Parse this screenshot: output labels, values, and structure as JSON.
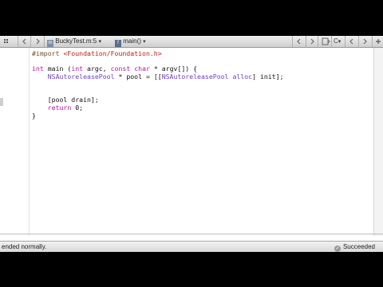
{
  "jump_bar": {
    "file": "BuckyTest.m:5",
    "function": "main()",
    "file_icon": "objc-file-icon",
    "function_icon": "function-icon"
  },
  "code_lines": [
    {
      "tokens": [
        {
          "c": "p",
          "t": "#import "
        },
        {
          "c": "s",
          "t": "<Foundation/Foundation.h>"
        }
      ]
    },
    {
      "tokens": []
    },
    {
      "tokens": [
        {
          "c": "k",
          "t": "int"
        },
        {
          "c": "",
          "t": " main ("
        },
        {
          "c": "k",
          "t": "int"
        },
        {
          "c": "",
          "t": " argc, "
        },
        {
          "c": "k",
          "t": "const"
        },
        {
          "c": "",
          "t": " "
        },
        {
          "c": "k",
          "t": "char"
        },
        {
          "c": "",
          "t": " * argv[]) {"
        }
      ]
    },
    {
      "tokens": [
        {
          "c": "",
          "t": "    "
        },
        {
          "c": "t",
          "t": "NSAutoreleasePool"
        },
        {
          "c": "",
          "t": " * pool = [["
        },
        {
          "c": "t",
          "t": "NSAutoreleasePool"
        },
        {
          "c": "",
          "t": " "
        },
        {
          "c": "t",
          "t": "alloc"
        },
        {
          "c": "",
          "t": "] init];"
        }
      ]
    },
    {
      "tokens": []
    },
    {
      "tokens": []
    },
    {
      "tokens": [
        {
          "c": "",
          "t": "    [pool drain];"
        }
      ]
    },
    {
      "tokens": [
        {
          "c": "",
          "t": "    "
        },
        {
          "c": "k",
          "t": "return"
        },
        {
          "c": "",
          "t": " 0;"
        }
      ]
    },
    {
      "tokens": [
        {
          "c": "",
          "t": "}"
        }
      ]
    }
  ],
  "console": {
    "text": "ended normally."
  },
  "status": {
    "label": "Succeeded"
  }
}
